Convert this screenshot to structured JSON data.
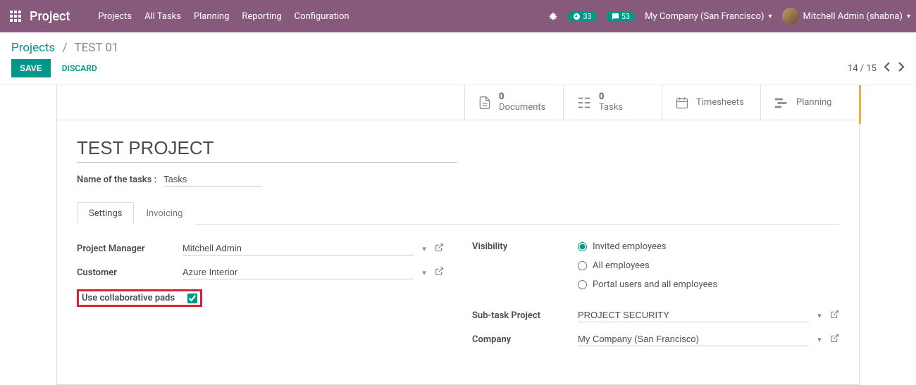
{
  "topbar": {
    "brand": "Project",
    "menu": [
      "Projects",
      "All Tasks",
      "Planning",
      "Reporting",
      "Configuration"
    ],
    "clock_badge": "33",
    "chat_badge": "53",
    "company": "My Company (San Francisco)",
    "user": "Mitchell Admin (shabna)"
  },
  "breadcrumb": {
    "root": "Projects",
    "current": "TEST 01"
  },
  "actions": {
    "save": "SAVE",
    "discard": "DISCARD"
  },
  "pager": {
    "text": "14 / 15"
  },
  "stats": {
    "documents": {
      "count": "0",
      "label": "Documents"
    },
    "tasks": {
      "count": "0",
      "label": "Tasks"
    },
    "timesheets": {
      "label": "Timesheets"
    },
    "planning": {
      "label": "Planning"
    }
  },
  "form": {
    "project_name": "TEST PROJECT",
    "tasks_label": "Name of the tasks :",
    "tasks_value": "Tasks",
    "tab_settings": "Settings",
    "tab_invoicing": "Invoicing",
    "left": {
      "pm_label": "Project Manager",
      "pm_value": "Mitchell Admin",
      "customer_label": "Customer",
      "customer_value": "Azure Interior",
      "pads_label": "Use collaborative pads"
    },
    "right": {
      "visibility_label": "Visibility",
      "vis_opt1": "Invited employees",
      "vis_opt2": "All employees",
      "vis_opt3": "Portal users and all employees",
      "subtask_label": "Sub-task Project",
      "subtask_value": "PROJECT SECURITY",
      "company_label": "Company",
      "company_value": "My Company (San Francisco)"
    }
  }
}
